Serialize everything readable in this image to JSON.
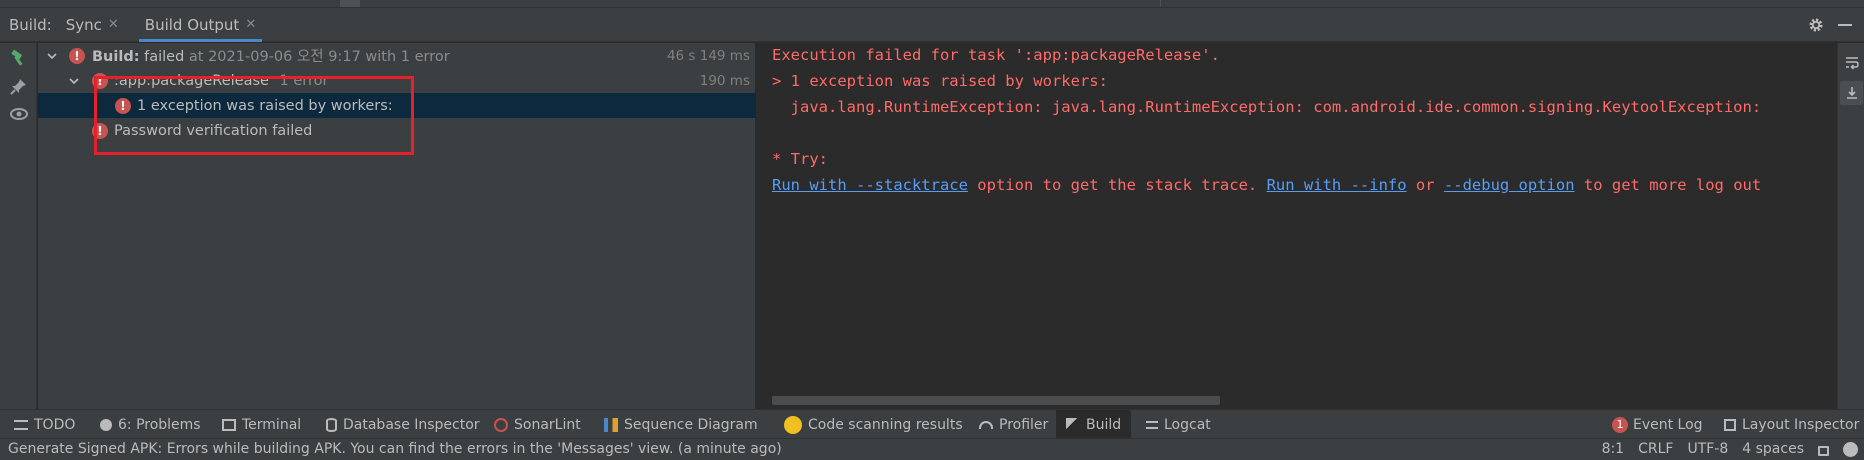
{
  "header": {
    "title": "Build:",
    "tabs": [
      {
        "label": "Sync",
        "active": false
      },
      {
        "label": "Build Output",
        "active": true
      }
    ]
  },
  "tree": {
    "root": {
      "label": "Build:",
      "status": "failed",
      "detail": "at 2021-09-06 오전 9:17 with 1 error",
      "time": "46 s 149 ms"
    },
    "task": {
      "label": ":app:packageRelease",
      "detail": "1 error",
      "time": "190 ms"
    },
    "exception": {
      "label": "1 exception was raised by workers:"
    },
    "password": {
      "label": "Password verification failed"
    }
  },
  "console": {
    "line1": "Execution failed for task ':app:packageRelease'.",
    "line2": "> 1 exception was raised by workers:",
    "line3": "  java.lang.RuntimeException: java.lang.RuntimeException: com.android.ide.common.signing.KeytoolException:",
    "line4": "* Try:",
    "line5": {
      "link1": "Run with --stacktrace",
      "text1": " option to get the stack trace. ",
      "link2": "Run with --info",
      "text2": " or ",
      "link3": "--debug option",
      "text3": " to get more log out"
    }
  },
  "bottom_tabs": [
    {
      "label": "TODO",
      "icon": "list-icon"
    },
    {
      "label": "6: Problems",
      "icon": "problems-icon"
    },
    {
      "label": "Terminal",
      "icon": "terminal-icon"
    },
    {
      "label": "Database Inspector",
      "icon": "database-icon"
    },
    {
      "label": "SonarLint",
      "icon": "sonarlint-icon"
    },
    {
      "label": "Sequence Diagram",
      "icon": "sequence-diagram-icon"
    },
    {
      "label": "Code scanning results",
      "icon": "code-scanning-icon"
    },
    {
      "label": "Profiler",
      "icon": "profiler-icon"
    },
    {
      "label": "Build",
      "icon": "hammer-icon",
      "active": true
    },
    {
      "label": "Logcat",
      "icon": "logcat-icon"
    },
    {
      "label": "Event Log",
      "icon": "event-log-icon",
      "badge": "1"
    },
    {
      "label": "Layout Inspector",
      "icon": "layout-inspector-icon"
    }
  ],
  "status": {
    "message": "Generate Signed APK: Errors while building APK. You can find the errors in the 'Messages' view. (a minute ago)",
    "position": "8:1",
    "line_ending": "CRLF",
    "encoding": "UTF-8",
    "indent": "4 spaces"
  },
  "colors": {
    "error": "#ff6b68",
    "link": "#589df6",
    "accent": "#4a88c7",
    "highlight_box": "#e8202a"
  }
}
